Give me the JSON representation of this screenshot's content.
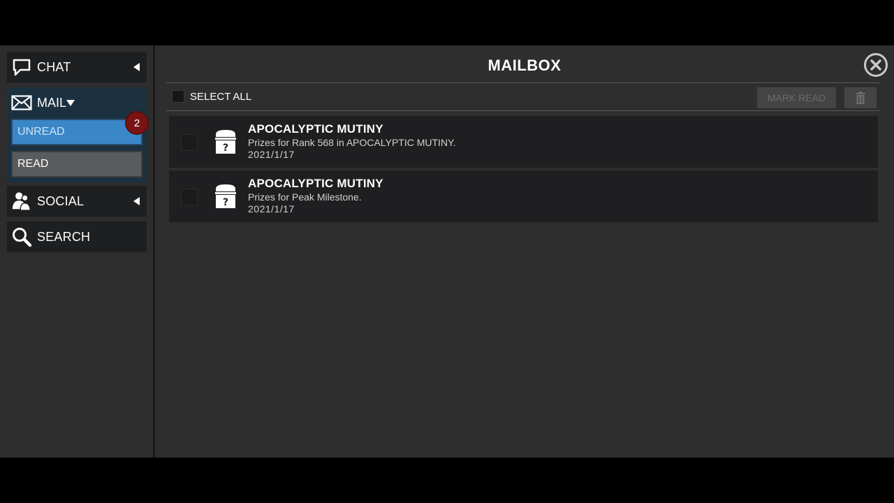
{
  "sidebar": {
    "chat_label": "CHAT",
    "mail_label": "MAIL",
    "unread_label": "UNREAD",
    "read_label": "READ",
    "unread_count": "2",
    "social_label": "SOCIAL",
    "search_label": "SEARCH"
  },
  "main": {
    "title": "MAILBOX",
    "select_all_label": "SELECT ALL",
    "mark_read_label": "MARK READ"
  },
  "mails": [
    {
      "subject": "APOCALYPTIC MUTINY",
      "description": "Prizes for Rank 568 in APOCALYPTIC MUTINY.",
      "date": "2021/1/17",
      "icon": "mystery-chest-icon"
    },
    {
      "subject": "APOCALYPTIC MUTINY",
      "description": "Prizes for Peak Milestone.",
      "date": "2021/1/17",
      "icon": "mystery-chest-icon"
    }
  ],
  "colors": {
    "panel_bg": "#2f2e2e",
    "nav_bg": "#1e1f21",
    "mail_group_bg": "#1c3140",
    "unread_tab": "#3a87c8",
    "read_tab": "#5a5b5c",
    "badge": "#7a1414",
    "row_bg": "#1f1f21"
  }
}
